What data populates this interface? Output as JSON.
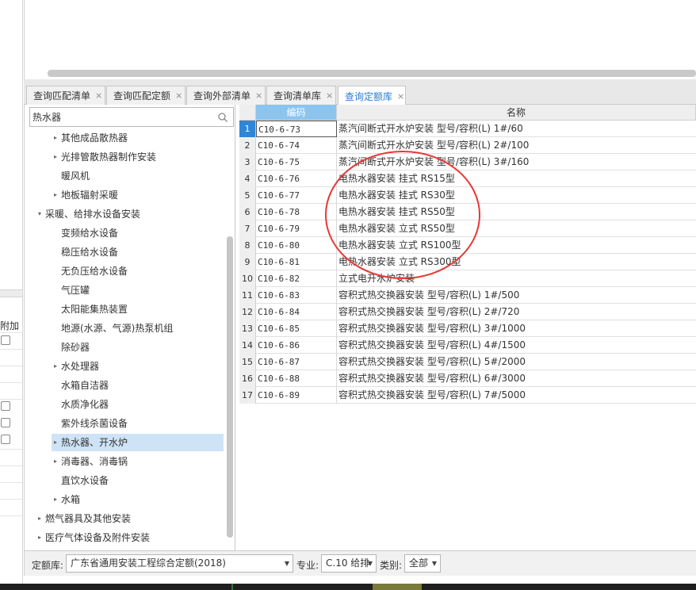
{
  "left_strip": {
    "label": "附加"
  },
  "tabs": [
    {
      "label": "查询匹配清单",
      "close": "×",
      "active": false
    },
    {
      "label": "查询匹配定额",
      "close": "×",
      "active": false
    },
    {
      "label": "查询外部清单",
      "close": "×",
      "active": false
    },
    {
      "label": "查询清单库",
      "close": "×",
      "active": false
    },
    {
      "label": "查询定额库",
      "close": "×",
      "active": true
    }
  ],
  "search": {
    "value": "热水器",
    "icon": "search-icon"
  },
  "tree": [
    {
      "label": "其他成品散热器",
      "arrow": "▸",
      "level": 2
    },
    {
      "label": "光排管散热器制作安装",
      "arrow": "▸",
      "level": 2
    },
    {
      "label": "暖风机",
      "arrow": "",
      "level": 2
    },
    {
      "label": "地板辐射采暖",
      "arrow": "▸",
      "level": 2
    },
    {
      "label": "采暖、给排水设备安装",
      "arrow": "▾",
      "level": 1
    },
    {
      "label": "变频给水设备",
      "arrow": "",
      "level": 2
    },
    {
      "label": "稳压给水设备",
      "arrow": "",
      "level": 2
    },
    {
      "label": "无负压给水设备",
      "arrow": "",
      "level": 2
    },
    {
      "label": "气压罐",
      "arrow": "",
      "level": 2
    },
    {
      "label": "太阳能集热装置",
      "arrow": "",
      "level": 2
    },
    {
      "label": "地源(水源、气源)热泵机组",
      "arrow": "",
      "level": 2
    },
    {
      "label": "除砂器",
      "arrow": "",
      "level": 2
    },
    {
      "label": "水处理器",
      "arrow": "▸",
      "level": 2
    },
    {
      "label": "水箱自洁器",
      "arrow": "",
      "level": 2
    },
    {
      "label": "水质净化器",
      "arrow": "",
      "level": 2
    },
    {
      "label": "紫外线杀菌设备",
      "arrow": "",
      "level": 2
    },
    {
      "label": "热水器、开水炉",
      "arrow": "▸",
      "level": 2,
      "selected": true
    },
    {
      "label": "消毒器、消毒锅",
      "arrow": "▸",
      "level": 2
    },
    {
      "label": "直饮水设备",
      "arrow": "",
      "level": 2
    },
    {
      "label": "水箱",
      "arrow": "▸",
      "level": 2
    },
    {
      "label": "燃气器具及其他安装",
      "arrow": "▸",
      "level": 1
    },
    {
      "label": "医疗气体设备及附件安装",
      "arrow": "▸",
      "level": 1
    }
  ],
  "grid": {
    "headers": {
      "code": "编码",
      "name": "名称"
    },
    "rows": [
      {
        "num": "1",
        "code": "C10-6-73",
        "name": "蒸汽间断式开水炉安装 型号/容积(L) 1#/60"
      },
      {
        "num": "2",
        "code": "C10-6-74",
        "name": "蒸汽间断式开水炉安装 型号/容积(L) 2#/100"
      },
      {
        "num": "3",
        "code": "C10-6-75",
        "name": "蒸汽间断式开水炉安装 型号/容积(L) 3#/160"
      },
      {
        "num": "4",
        "code": "C10-6-76",
        "name": "电热水器安装 挂式 RS15型"
      },
      {
        "num": "5",
        "code": "C10-6-77",
        "name": "电热水器安装 挂式 RS30型"
      },
      {
        "num": "6",
        "code": "C10-6-78",
        "name": "电热水器安装 挂式 RS50型"
      },
      {
        "num": "7",
        "code": "C10-6-79",
        "name": "电热水器安装 立式 RS50型"
      },
      {
        "num": "8",
        "code": "C10-6-80",
        "name": "电热水器安装 立式 RS100型"
      },
      {
        "num": "9",
        "code": "C10-6-81",
        "name": "电热水器安装 立式 RS300型"
      },
      {
        "num": "10",
        "code": "C10-6-82",
        "name": "立式电开水炉安装"
      },
      {
        "num": "11",
        "code": "C10-6-83",
        "name": "容积式热交换器安装 型号/容积(L) 1#/500"
      },
      {
        "num": "12",
        "code": "C10-6-84",
        "name": "容积式热交换器安装 型号/容积(L) 2#/720"
      },
      {
        "num": "13",
        "code": "C10-6-85",
        "name": "容积式热交换器安装 型号/容积(L) 3#/1000"
      },
      {
        "num": "14",
        "code": "C10-6-86",
        "name": "容积式热交换器安装 型号/容积(L) 4#/1500"
      },
      {
        "num": "15",
        "code": "C10-6-87",
        "name": "容积式热交换器安装 型号/容积(L) 5#/2000"
      },
      {
        "num": "16",
        "code": "C10-6-88",
        "name": "容积式热交换器安装 型号/容积(L) 6#/3000"
      },
      {
        "num": "17",
        "code": "C10-6-89",
        "name": "容积式热交换器安装 型号/容积(L) 7#/5000"
      }
    ]
  },
  "filter_bar": {
    "quota_label": "定额库:",
    "quota_value": "广东省通用安装工程综合定额(2018)",
    "major_label": "专业:",
    "major_value": "C.10 给排",
    "category_label": "类别:",
    "category_value": "全部"
  },
  "colors": {
    "active_tab_text": "#2a7bd0",
    "selected_tree_bg": "#cfe3f7",
    "header_highlight": "#8cc4ee",
    "row_number_active": "#2f86d6",
    "annotation": "#e53935"
  }
}
